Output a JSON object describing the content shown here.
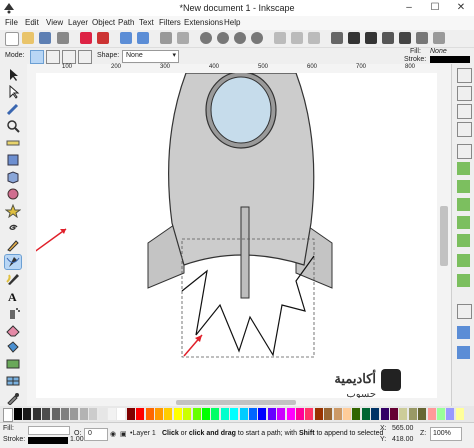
{
  "window": {
    "title": "*New document 1 - Inkscape",
    "minimize": "–",
    "maximize": "☐",
    "close": "✕"
  },
  "menu": [
    "File",
    "Edit",
    "View",
    "Layer",
    "Object",
    "Path",
    "Text",
    "Filters",
    "Extensions",
    "Help"
  ],
  "controls": {
    "mode_label": "Mode:",
    "shape_label": "Shape:",
    "shape_value": "None"
  },
  "style_indicator": {
    "fill_label": "Fill:",
    "fill_value": "None",
    "stroke_label": "Stroke:"
  },
  "ruler_ticks": [
    "100",
    "200",
    "300",
    "400",
    "500",
    "600",
    "700",
    "800"
  ],
  "palette_colors": [
    "#000000",
    "#1a1a1a",
    "#333333",
    "#4d4d4d",
    "#666666",
    "#808080",
    "#999999",
    "#b3b3b3",
    "#cccccc",
    "#e6e6e6",
    "#f2f2f2",
    "#ffffff",
    "#800000",
    "#ff0000",
    "#ff6600",
    "#ff9900",
    "#ffcc00",
    "#ffff00",
    "#ccff00",
    "#66ff00",
    "#00ff00",
    "#00ff66",
    "#00ffcc",
    "#00ffff",
    "#00ccff",
    "#0066ff",
    "#0000ff",
    "#6600ff",
    "#cc00ff",
    "#ff00ff",
    "#ff0099",
    "#ff3366",
    "#993300",
    "#996633",
    "#cc9966",
    "#ffcc99",
    "#336600",
    "#006633",
    "#003366",
    "#330066",
    "#660033",
    "#cccc99",
    "#999966",
    "#666633",
    "#ff9999",
    "#99ff99",
    "#9999ff",
    "#ffff99"
  ],
  "status": {
    "fill_label": "Fill:",
    "stroke_label": "Stroke:",
    "opacity_label": "O:",
    "opacity_value": "0",
    "stroke_width": "1.00",
    "layer": "•Layer 1",
    "message_bold1": "Click",
    "message_text1": " or ",
    "message_bold2": "click and drag",
    "message_text2": " to start a path; with ",
    "message_bold3": "Shift",
    "message_text3": " to append to selected",
    "x_label": "X:",
    "x_value": "565.00",
    "y_label": "Y:",
    "y_value": "418.00",
    "z_label": "Z:",
    "zoom": "100%"
  },
  "watermark": {
    "arabic_top": "أكاديمية",
    "arabic_bottom": "حسوب"
  },
  "colors": {
    "rocket_body": "#cccccc",
    "rocket_stroke": "#333333",
    "window_fill": "#c6dceb",
    "arrow": "#e0202a",
    "active_tool": "#b8d6f5"
  }
}
